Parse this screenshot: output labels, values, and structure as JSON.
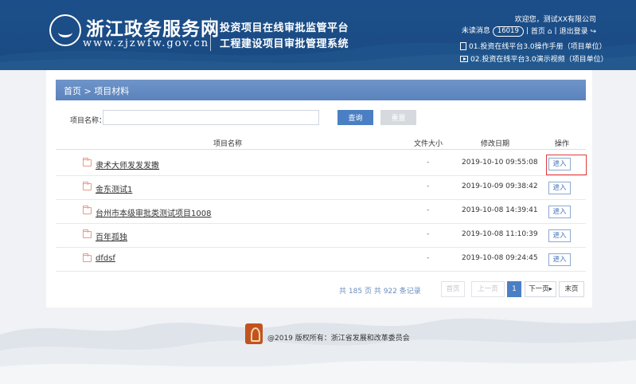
{
  "header": {
    "logo_cn": "浙江政务服务网",
    "logo_url": "www.zjzwfw.gov.cn",
    "system_line1": "投资项目在线审批监管平台",
    "system_line2": "工程建设项目审批管理系统",
    "welcome": "欢迎您，测试XX有限公司",
    "unread_label": "未读消息",
    "unread_count": "16019",
    "home_link": "首页",
    "logout_link": "退出登录",
    "manual_1": "01.投资在线平台3.0操作手册（项目单位）",
    "manual_2": "02.投资在线平台3.0演示视频（项目单位）"
  },
  "breadcrumb": "首页 > 项目材料",
  "search": {
    "label": "项目名称：",
    "value": "",
    "placeholder": "",
    "query_button": "查询",
    "reset_button": "重置"
  },
  "table": {
    "columns": [
      "项目名称",
      "文件大小",
      "修改日期",
      "操作"
    ],
    "rows": [
      {
        "name": "隶术大师发发发撒",
        "size": "-",
        "date": "2019-10-10 09:55:08",
        "action": "进入"
      },
      {
        "name": "金东测试1",
        "size": "-",
        "date": "2019-10-09 09:38:42",
        "action": "进入"
      },
      {
        "name": "台州市本级审批类测试项目1008",
        "size": "-",
        "date": "2019-10-08 14:39:41",
        "action": "进入"
      },
      {
        "name": "百年孤独",
        "size": "-",
        "date": "2019-10-08 11:10:39",
        "action": "进入"
      },
      {
        "name": "dfdsf",
        "size": "-",
        "date": "2019-10-08 09:24:45",
        "action": "进入"
      }
    ]
  },
  "pagination": {
    "total_prefix": "共",
    "total_pages": "185",
    "pages_label": "页 共",
    "total_records": "922",
    "records_label": "条记录",
    "first": "首页",
    "prev": "上一页",
    "current": "1",
    "next": "下一页",
    "last": "末页"
  },
  "footer": {
    "text": "@2019  版权所有：浙江省发展和改革委员会"
  },
  "colors": {
    "header_bg": "#1c4f8a",
    "breadcrumb_bg": "#5a83bd",
    "primary_button": "#4b7fc4",
    "highlight_box": "#e03a3a"
  }
}
